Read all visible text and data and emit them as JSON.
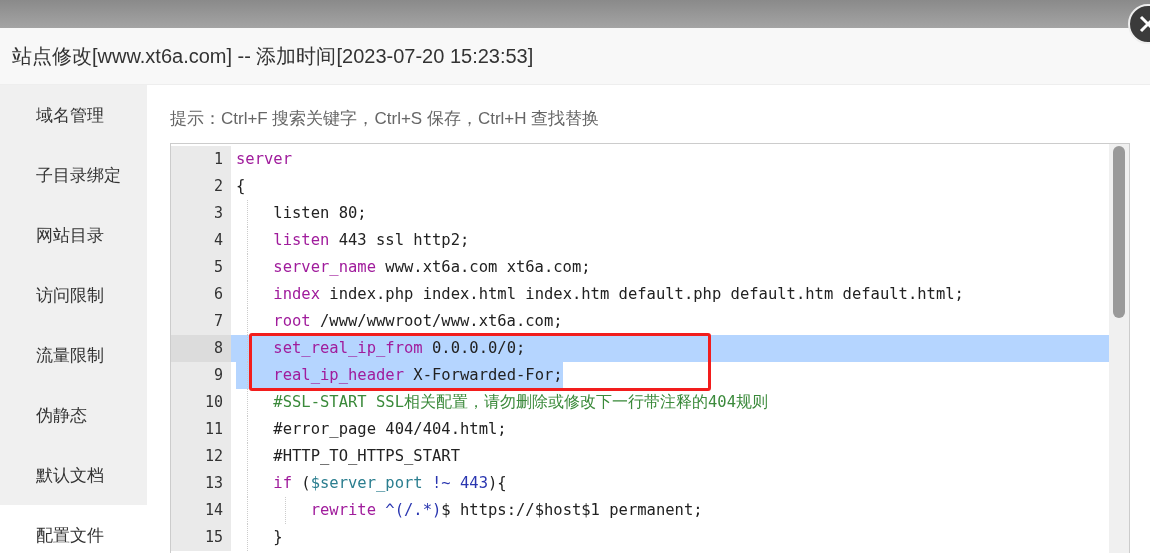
{
  "dialog": {
    "title": "站点修改[www.xt6a.com] -- 添加时间[2023-07-20 15:23:53]"
  },
  "sidebar": {
    "items": [
      {
        "label": "域名管理",
        "selected": false
      },
      {
        "label": "子目录绑定",
        "selected": false
      },
      {
        "label": "网站目录",
        "selected": false
      },
      {
        "label": "访问限制",
        "selected": false
      },
      {
        "label": "流量限制",
        "selected": false
      },
      {
        "label": "伪静态",
        "selected": false
      },
      {
        "label": "默认文档",
        "selected": false
      },
      {
        "label": "配置文件",
        "selected": true
      }
    ]
  },
  "hint": "提示：Ctrl+F 搜索关键字，Ctrl+S 保存，Ctrl+H 查找替换",
  "editor": {
    "lines": [
      {
        "number": "1",
        "selected": false,
        "tokens": [
          {
            "kind": "keyword",
            "text": "server"
          }
        ]
      },
      {
        "number": "2",
        "selected": false,
        "tokens": [
          {
            "kind": "plain",
            "text": "{"
          }
        ]
      },
      {
        "number": "3",
        "selected": false,
        "tokens": [
          {
            "kind": "plain",
            "text": "    listen 80;"
          }
        ]
      },
      {
        "number": "4",
        "selected": false,
        "tokens": [
          {
            "kind": "keyword",
            "text": "    listen"
          },
          {
            "kind": "plain",
            "text": " 443 ssl http2;"
          }
        ]
      },
      {
        "number": "5",
        "selected": false,
        "tokens": [
          {
            "kind": "keyword",
            "text": "    server_name"
          },
          {
            "kind": "plain",
            "text": " www.xt6a.com xt6a.com;"
          }
        ]
      },
      {
        "number": "6",
        "selected": false,
        "tokens": [
          {
            "kind": "keyword",
            "text": "    index"
          },
          {
            "kind": "plain",
            "text": " index.php index.html index.htm default.php default.htm default.html;"
          }
        ]
      },
      {
        "number": "7",
        "selected": false,
        "tokens": [
          {
            "kind": "keyword",
            "text": "    root"
          },
          {
            "kind": "plain",
            "text": " /www/wwwroot/www.xt6a.com;"
          }
        ]
      },
      {
        "number": "8",
        "selected": true,
        "tokens": [
          {
            "kind": "keyword",
            "text": "    set_real_ip_from"
          },
          {
            "kind": "plain",
            "text": " 0.0.0.0/0;"
          }
        ]
      },
      {
        "number": "9",
        "selected": true,
        "tokens": [
          {
            "kind": "keyword",
            "text": "    real_ip_header"
          },
          {
            "kind": "plain",
            "text": " X-Forwarded-For;"
          }
        ]
      },
      {
        "number": "10",
        "selected": false,
        "tokens": [
          {
            "kind": "comment",
            "text": "    #SSL-START SSL相关配置，请勿删除或修改下一行带注释的404规则"
          }
        ]
      },
      {
        "number": "11",
        "selected": false,
        "tokens": [
          {
            "kind": "plain",
            "text": "    #error_page 404/404.html;"
          }
        ]
      },
      {
        "number": "12",
        "selected": false,
        "tokens": [
          {
            "kind": "plain",
            "text": "    #HTTP_TO_HTTPS_START"
          }
        ]
      },
      {
        "number": "13",
        "selected": false,
        "tokens": [
          {
            "kind": "keyword",
            "text": "    if"
          },
          {
            "kind": "plain",
            "text": " ("
          },
          {
            "kind": "variable",
            "text": "$server_port"
          },
          {
            "kind": "operator",
            "text": " !~ 443"
          },
          {
            "kind": "plain",
            "text": "){"
          }
        ]
      },
      {
        "number": "14",
        "selected": false,
        "tokens": [
          {
            "kind": "keyword",
            "text": "        rewrite"
          },
          {
            "kind": "operator",
            "text": " ^(/.*)"
          },
          {
            "kind": "plain",
            "text": "$ https://$host$1 permanent;"
          }
        ]
      },
      {
        "number": "15",
        "selected": false,
        "tokens": [
          {
            "kind": "plain",
            "text": "    }"
          }
        ]
      }
    ]
  }
}
